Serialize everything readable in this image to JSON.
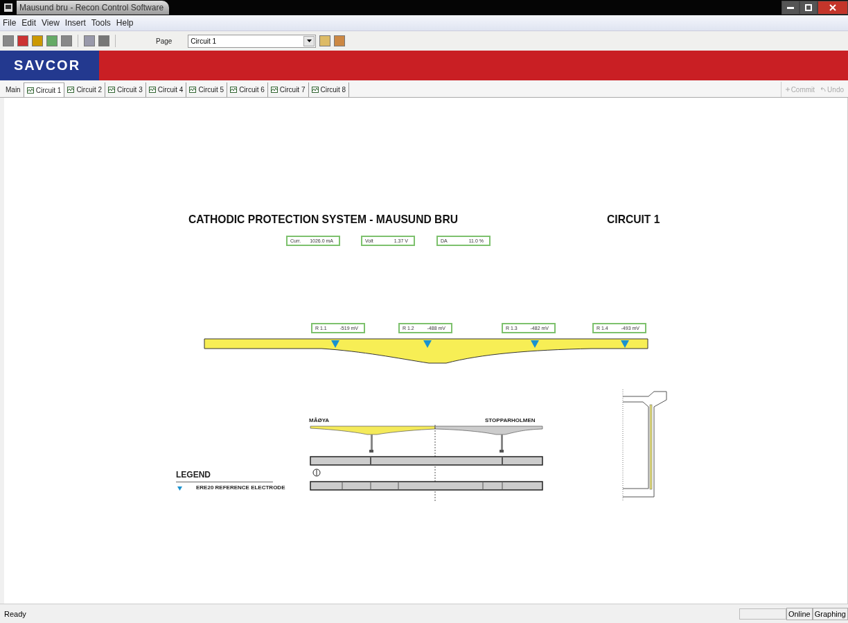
{
  "window": {
    "title": "Mausund bru - Recon Control Software"
  },
  "menu": [
    "File",
    "Edit",
    "View",
    "Insert",
    "Tools",
    "Help"
  ],
  "toolbar": {
    "page_label": "Page",
    "page_value": "Circuit 1"
  },
  "banner": {
    "logo": "SAVCOR"
  },
  "tabs": [
    {
      "label": "Main",
      "kind": "plain",
      "selected": false
    },
    {
      "label": "Circuit 1",
      "kind": "graph",
      "selected": true
    },
    {
      "label": "Circuit 2",
      "kind": "graph",
      "selected": false
    },
    {
      "label": "Circuit 3",
      "kind": "graph",
      "selected": false
    },
    {
      "label": "Circuit 4",
      "kind": "graph",
      "selected": false
    },
    {
      "label": "Circuit 5",
      "kind": "graph",
      "selected": false
    },
    {
      "label": "Circuit 6",
      "kind": "graph",
      "selected": false
    },
    {
      "label": "Circuit 7",
      "kind": "graph",
      "selected": false
    },
    {
      "label": "Circuit 8",
      "kind": "graph",
      "selected": false
    }
  ],
  "actions": [
    {
      "label": "Commit",
      "kind": "commit",
      "disabled": true
    },
    {
      "label": "Undo",
      "kind": "undo",
      "disabled": true
    }
  ],
  "diagram": {
    "title": "CATHODIC PROTECTION SYSTEM - MAUSUND BRU",
    "circuit": "CIRCUIT 1",
    "readouts": [
      {
        "label": "Curr.",
        "value": "1026.0 mA"
      },
      {
        "label": "Volt",
        "value": "1.37 V"
      },
      {
        "label": "DA",
        "value": "11.0 %"
      }
    ],
    "electrodes": [
      {
        "label": "R 1.1",
        "value": "-519 mV"
      },
      {
        "label": "R 1.2",
        "value": "-488 mV"
      },
      {
        "label": "R 1.3",
        "value": "-482 mV"
      },
      {
        "label": "R 1.4",
        "value": "-493 mV"
      }
    ],
    "plan": {
      "left_label": "MÅØYA",
      "right_label": "STOPPARHOLMEN"
    },
    "legend": {
      "title": "LEGEND",
      "item": "ERE20 REFERENCE ELECTRODE"
    }
  },
  "status_bar": {
    "text": "Ready",
    "panels": [
      "Online",
      "Graphing"
    ]
  }
}
